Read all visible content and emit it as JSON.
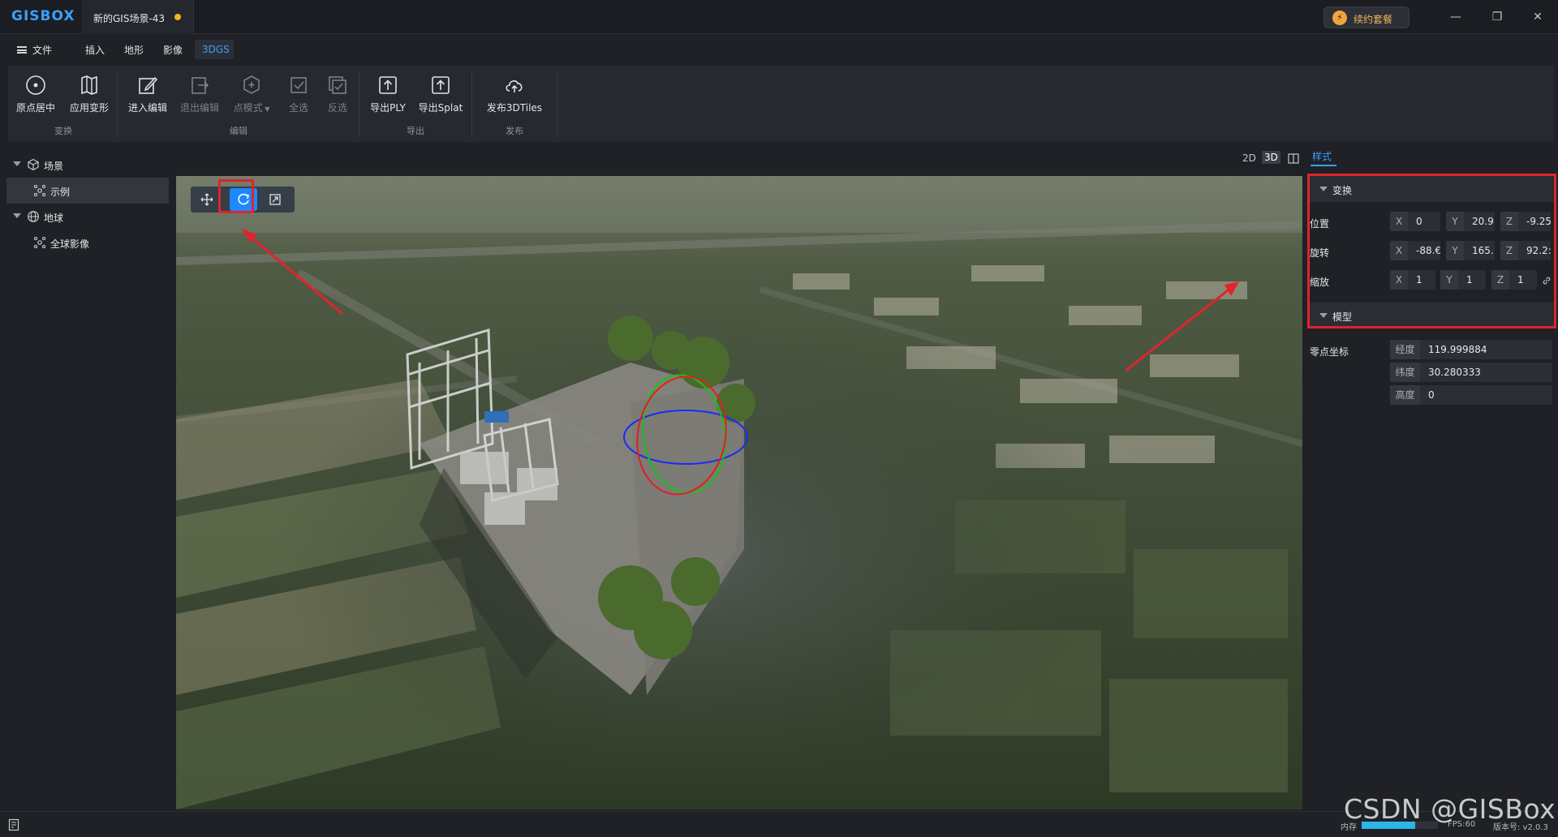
{
  "app": {
    "logo": "GISBOX",
    "doc_tab": "新的GIS场景-43",
    "renew_button": "续约套餐",
    "colors": {
      "accent": "#1e88ff",
      "brand": "#3aa0ff",
      "unsaved_dot": "#f2b51b",
      "highlight_box": "#e0242b"
    }
  },
  "window_controls": {
    "minimize": "—",
    "maximize": "❐",
    "close": "✕"
  },
  "menu": {
    "file": "文件",
    "items": [
      "插入",
      "地形",
      "影像"
    ],
    "active_tab": "3DGS"
  },
  "ribbon": {
    "groups": [
      {
        "label": "变换",
        "tools": [
          "原点居中",
          "应用变形"
        ]
      },
      {
        "label": "编辑",
        "tools": [
          "进入编辑",
          "退出编辑",
          "点模式",
          "全选",
          "反选"
        ]
      },
      {
        "label": "导出",
        "tools": [
          "导出PLY",
          "导出Splat"
        ]
      },
      {
        "label": "发布",
        "tools": [
          "发布3DTiles"
        ]
      }
    ]
  },
  "tree": {
    "nodes": [
      {
        "label": "场景",
        "icon": "cube-icon"
      },
      {
        "label": "示例",
        "icon": "splat-icon",
        "selected": true
      },
      {
        "label": "地球",
        "icon": "globe-icon"
      },
      {
        "label": "全球影像",
        "icon": "splat-icon"
      }
    ]
  },
  "viewport": {
    "gizmo_modes": [
      "move-icon",
      "rotate-icon",
      "scale-icon"
    ],
    "active_gizmo": "rotate",
    "view_modes": [
      "2D",
      "3D",
      "split"
    ],
    "active_view_mode": "3D"
  },
  "properties": {
    "tab": "样式",
    "transform": {
      "title": "变换",
      "position": {
        "label": "位置",
        "x": "0",
        "y": "20.9!",
        "z": "-9.25"
      },
      "rotation": {
        "label": "旋转",
        "x": "-88.€",
        "y": "165.:",
        "z": "92.2:"
      },
      "scale": {
        "label": "缩放",
        "x": "1",
        "y": "1",
        "z": "1"
      }
    },
    "model": {
      "title": "模型",
      "origin_label": "零点坐标",
      "longitude": {
        "key": "经度",
        "value": "119.999884"
      },
      "latitude": {
        "key": "纬度",
        "value": "30.280333"
      },
      "height": {
        "key": "高度",
        "value": "0"
      }
    }
  },
  "status": {
    "memory_label": "内存",
    "memory_usage": 0.7,
    "fps": "FPS:60",
    "version": "版本号: v2.0.3"
  },
  "watermark": "CSDN @GISBox"
}
